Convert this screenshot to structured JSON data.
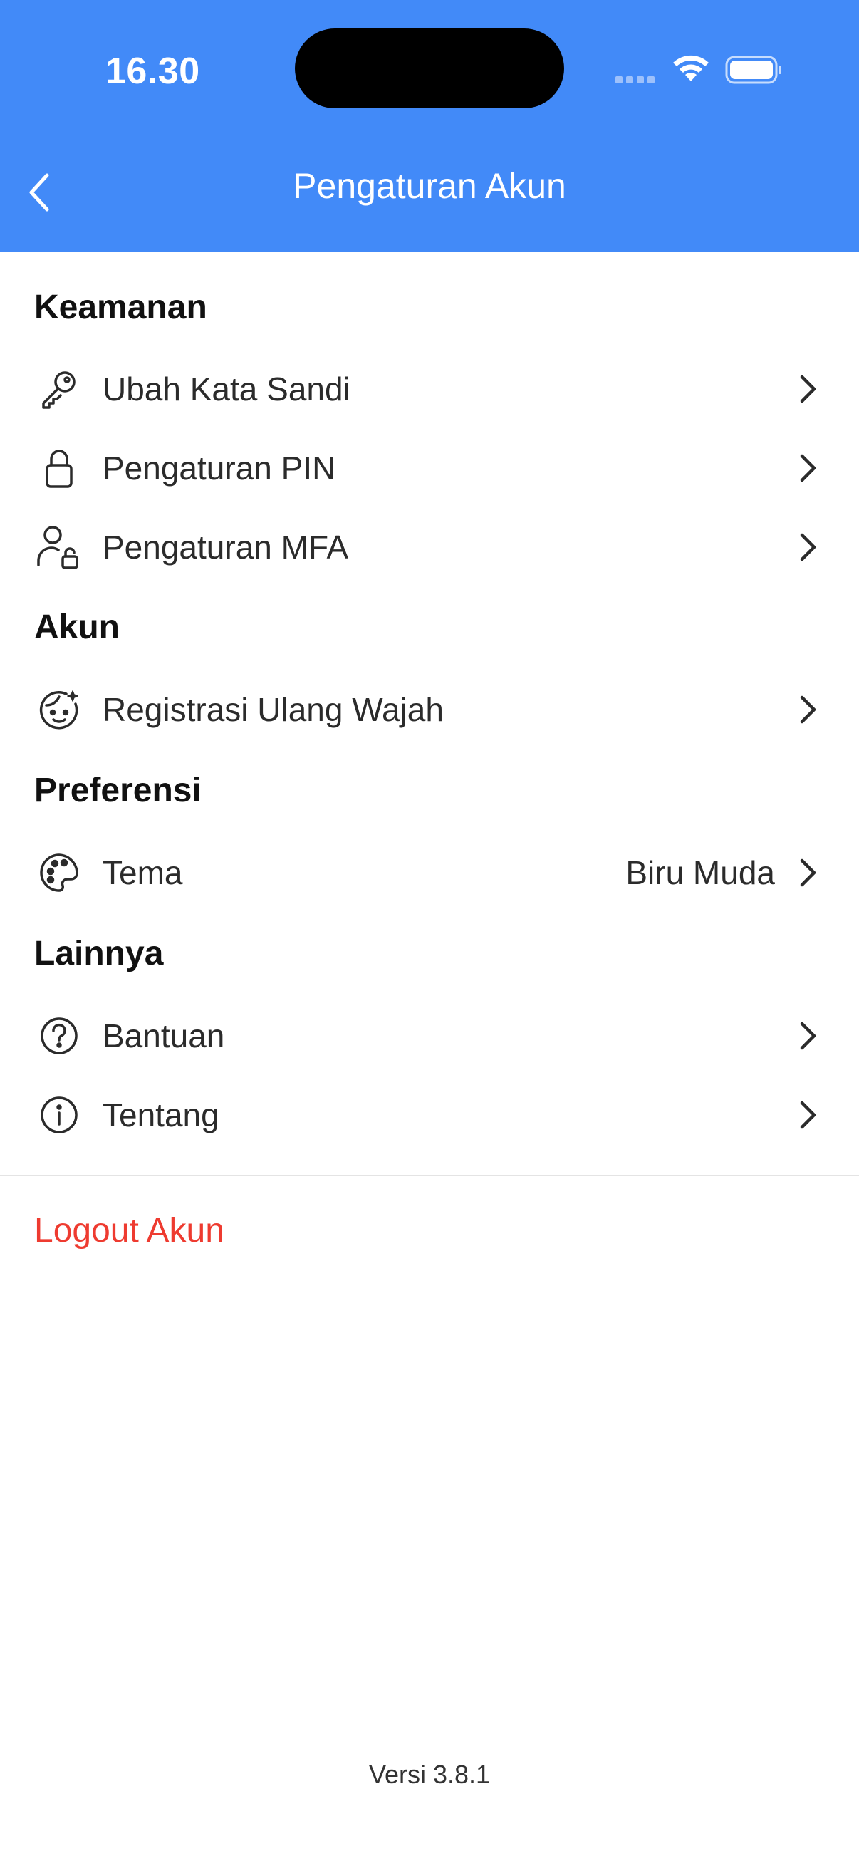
{
  "status_bar": {
    "time": "16.30"
  },
  "header": {
    "title": "Pengaturan Akun",
    "background": "#428af8"
  },
  "sections": {
    "keamanan": {
      "title": "Keamanan",
      "items": [
        {
          "label": "Ubah Kata Sandi",
          "icon": "key-icon"
        },
        {
          "label": "Pengaturan PIN",
          "icon": "lock-icon"
        },
        {
          "label": "Pengaturan MFA",
          "icon": "user-lock-icon"
        }
      ]
    },
    "akun": {
      "title": "Akun",
      "items": [
        {
          "label": "Registrasi Ulang Wajah",
          "icon": "face-icon"
        }
      ]
    },
    "preferensi": {
      "title": "Preferensi",
      "items": [
        {
          "label": "Tema",
          "value": "Biru Muda",
          "icon": "palette-icon"
        }
      ]
    },
    "lainnya": {
      "title": "Lainnya",
      "items": [
        {
          "label": "Bantuan",
          "icon": "help-icon"
        },
        {
          "label": "Tentang",
          "icon": "info-icon"
        }
      ]
    }
  },
  "logout_label": "Logout Akun",
  "logout_color": "#ee3b30",
  "version": "Versi 3.8.1"
}
